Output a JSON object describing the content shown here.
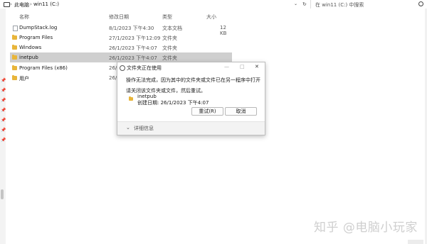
{
  "breadcrumb": {
    "items": [
      "此电脑",
      "win11 (C:)"
    ],
    "separator": "›"
  },
  "search": {
    "placeholder": "在 win11 (C:) 中搜索"
  },
  "columns": {
    "name": "名称",
    "date": "修改日期",
    "type": "类型",
    "size": "大小"
  },
  "files": [
    {
      "name": "DumpStack.log",
      "date": "8/1/2023 下午4:30",
      "type": "文本文档",
      "size": "12 KB",
      "icon": "text-file-icon"
    },
    {
      "name": "Program Files",
      "date": "27/1/2023 下午12:09",
      "type": "文件夹",
      "size": "",
      "icon": "folder-icon"
    },
    {
      "name": "Windows",
      "date": "26/1/2023 下午4:07",
      "type": "文件夹",
      "size": "",
      "icon": "folder-icon"
    },
    {
      "name": "inetpub",
      "date": "26/1/2023 下午4:07",
      "type": "文件夹",
      "size": "",
      "icon": "folder-icon",
      "selected": true
    },
    {
      "name": "Program Files (x86)",
      "date": "26/",
      "type": "",
      "size": "",
      "icon": "folder-icon"
    },
    {
      "name": "用户",
      "date": "26/",
      "type": "",
      "size": "",
      "icon": "folder-icon"
    }
  ],
  "dialog": {
    "title": "文件夹正在使用",
    "message": "操作无法完成，因为其中的文件夹或文件已在另一程序中打开",
    "instruction": "请关闭该文件夹或文件，然后重试。",
    "item_name": "inetpub",
    "item_created": "创建日期: 26/1/2023 下午4:07",
    "retry_label": "重试(R)",
    "cancel_label": "取消",
    "more_label": "详细信息"
  },
  "watermark": "知乎 @电脑小玩家",
  "colors": {
    "selection": "#cfcfcf",
    "folder": "#e8b53a"
  }
}
